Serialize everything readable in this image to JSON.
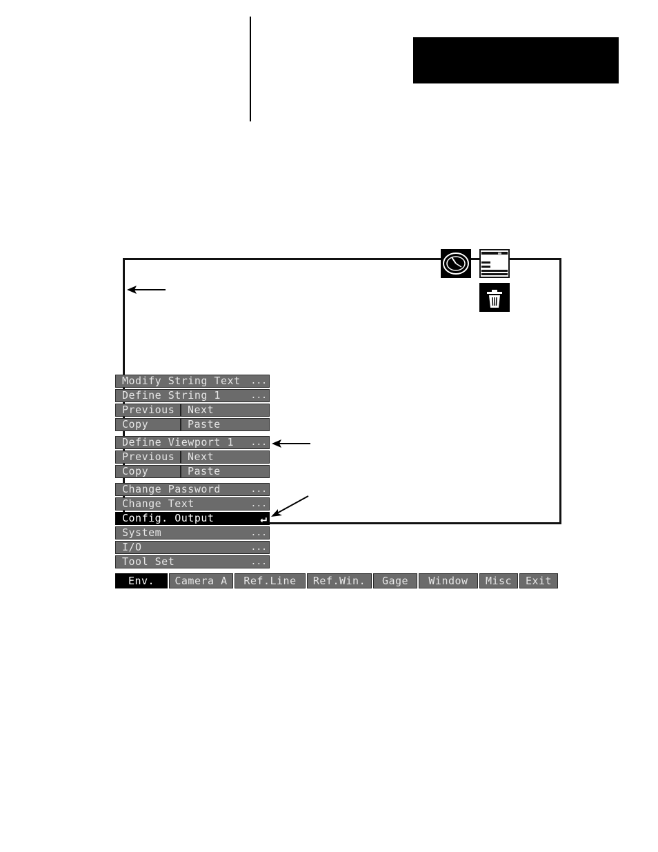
{
  "string_menu": {
    "modify": "Modify String Text",
    "define": "Define String 1",
    "previous": "Previous",
    "next": "Next",
    "copy": "Copy",
    "paste": "Paste"
  },
  "viewport_menu": {
    "define": "Define Viewport 1",
    "previous": "Previous",
    "next": "Next",
    "copy": "Copy",
    "paste": "Paste"
  },
  "env_menu": {
    "items": [
      "Change Password",
      "Change Text",
      "Config. Output",
      "System",
      "I/O",
      "Tool Set"
    ],
    "selected": "Config. Output"
  },
  "ellipsis": "...",
  "enter_glyph": "↵",
  "menubar": [
    "Env.",
    "Camera A",
    "Ref.Line",
    "Ref.Win.",
    "Gage",
    "Window",
    "Misc",
    "Exit"
  ],
  "menubar_active": "Env.",
  "icons": [
    "gauge-icon",
    "window-icon",
    "trash-icon",
    "arrow-icon"
  ]
}
